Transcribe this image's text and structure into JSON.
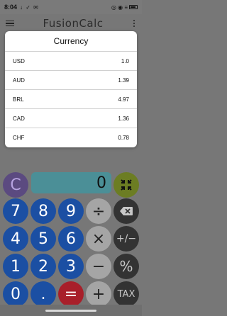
{
  "status_bar": {
    "time": "8:04",
    "notification_icons": "↓ ✓ ✉",
    "system_icons": "◎ ◉ ≡"
  },
  "app_bar": {
    "title": "FusionCalc"
  },
  "currency_sheet": {
    "title": "Currency",
    "rows": [
      {
        "code": "USD",
        "rate": "1.0"
      },
      {
        "code": "AUD",
        "rate": "1.39"
      },
      {
        "code": "BRL",
        "rate": "4.97"
      },
      {
        "code": "CAD",
        "rate": "1.36"
      },
      {
        "code": "CHF",
        "rate": "0.78"
      }
    ]
  },
  "calculator": {
    "display_value": "0",
    "keys": {
      "clear": "C",
      "seven": "7",
      "eight": "8",
      "nine": "9",
      "divide": "÷",
      "four": "4",
      "five": "5",
      "six": "6",
      "multiply": "×",
      "plus_minus": "+/−",
      "one": "1",
      "two": "2",
      "three": "3",
      "minus": "−",
      "percent": "%",
      "zero": "0",
      "decimal": ".",
      "equals": "=",
      "plus": "+",
      "tax": "TAX"
    }
  },
  "colors": {
    "number_key": "#1b4fa3",
    "operator_key": "#a5a5a5",
    "dark_key": "#333333",
    "equals_key": "#a81f2a",
    "clear_key": "#5b4a80",
    "fit_key": "#6c7d23",
    "display": "#4b8f97"
  }
}
